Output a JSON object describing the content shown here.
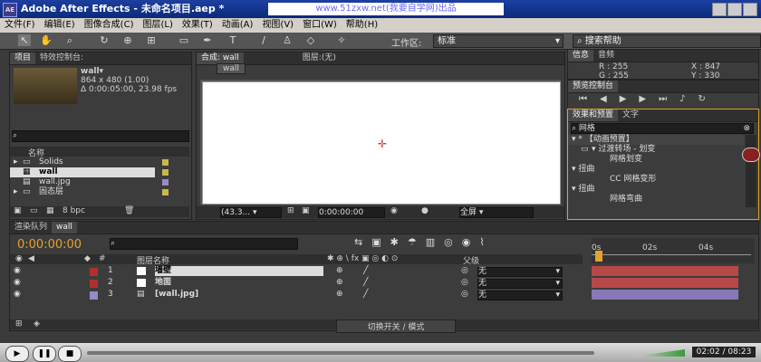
{
  "window": {
    "title": "Adobe After Effects - 未命名项目.aep *",
    "logo": "AE",
    "watermark": "www.51zxw.net(我要自学网)出品"
  },
  "menu": [
    "文件(F)",
    "编辑(E)",
    "图像合成(C)",
    "图层(L)",
    "效果(T)",
    "动画(A)",
    "视图(V)",
    "窗口(W)",
    "帮助(H)"
  ],
  "toolbar": {
    "workspace_label": "工作区:",
    "workspace_value": "标准",
    "search_help": "搜索帮助"
  },
  "project": {
    "tabs": [
      "项目",
      "特效控制台:"
    ],
    "item_name": "wall▾",
    "item_size": "864 x 480 (1.00)",
    "item_duration": "Δ 0:00:05:00, 23.98 fps",
    "col_name": "名称",
    "bpc": "8 bpc",
    "items": [
      {
        "name": "Solids",
        "icon": "folder-icon",
        "color": "#c8b84a"
      },
      {
        "name": "wall",
        "icon": "composition-icon",
        "color": "#c8b84a"
      },
      {
        "name": "wall.jpg",
        "icon": "image-file-icon",
        "color": "#9a8ac8"
      },
      {
        "name": "固态层",
        "icon": "folder-icon",
        "color": "#c8b84a"
      }
    ]
  },
  "composition": {
    "tab": "合成: wall",
    "layer_tab": "图层:(无)",
    "comp_button": "wall",
    "zoom": "(43.3...",
    "timecode": "0:00:00:00",
    "view": "全屏"
  },
  "info": {
    "tabs": [
      "信息",
      "音频"
    ],
    "r": "R : 255",
    "g": "G : 255",
    "x": "X : 847",
    "y": "Y : 330"
  },
  "preview": {
    "tab": "预览控制台"
  },
  "effects": {
    "tabs": [
      "效果和预置",
      "文字"
    ],
    "search": "网格",
    "items": [
      {
        "label": "▾ * 【动画预置】",
        "indent": 4
      },
      {
        "label": "▾ 过渡转场 - 划变",
        "indent": 14
      },
      {
        "label": "网格划变",
        "indent": 46
      },
      {
        "label": "▾ 扭曲",
        "indent": 4
      },
      {
        "label": "CC 网格变形",
        "indent": 46
      },
      {
        "label": "▾ 扭曲",
        "indent": 4
      },
      {
        "label": "网格弯曲",
        "indent": 46
      }
    ]
  },
  "timeline": {
    "tabs": [
      "渲染队列",
      "wall"
    ],
    "timecode": "0:00:00:00",
    "col_layer_name": "图层名称",
    "col_parent": "父级",
    "ruler": [
      "0s",
      "02s",
      "04s"
    ],
    "layers": [
      {
        "num": "1",
        "name": "墙壁",
        "color": "#b03030",
        "parent": "无",
        "bar": "#b84848"
      },
      {
        "num": "2",
        "name": "地面",
        "color": "#b03030",
        "parent": "无",
        "bar": "#b84848"
      },
      {
        "num": "3",
        "name": "[wall.jpg]",
        "color": "#9a8ac8",
        "parent": "无",
        "bar": "#8878b8"
      }
    ],
    "toggle_label": "切换开关 / 模式"
  },
  "player": {
    "time": "02:02 / 08:23"
  }
}
